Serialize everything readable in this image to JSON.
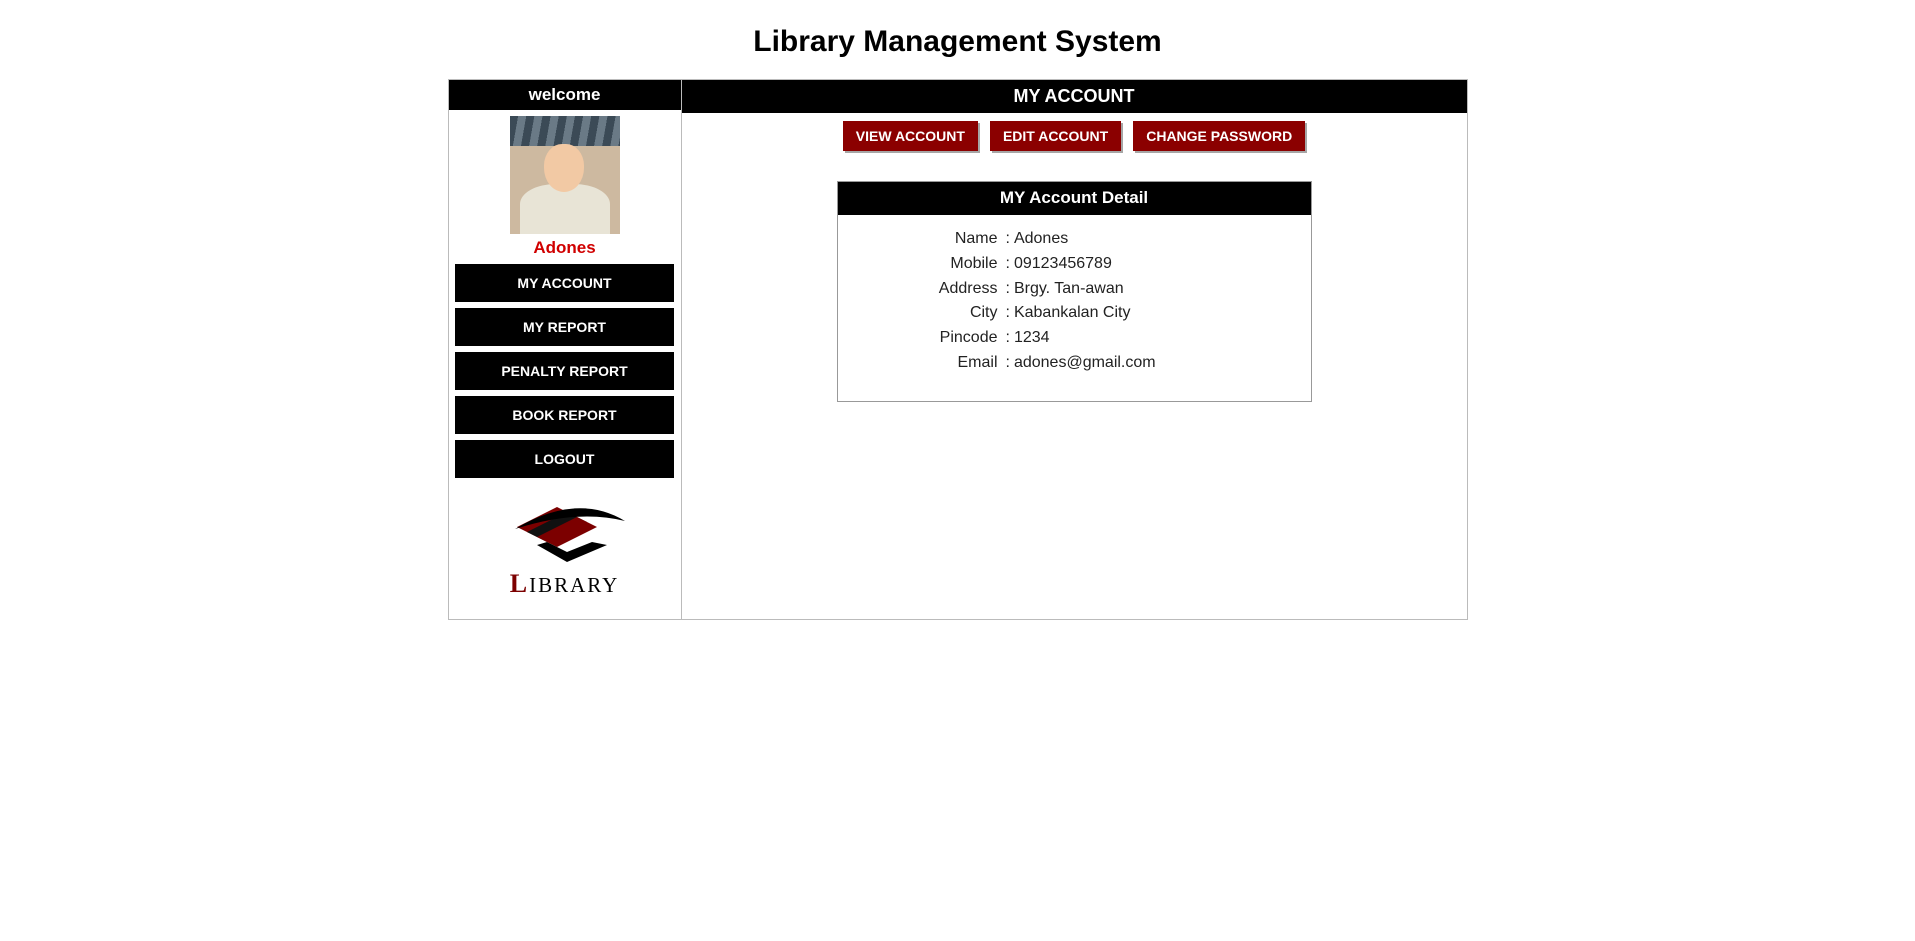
{
  "page_title": "Library Management System",
  "sidebar": {
    "welcome": "welcome",
    "username": "Adones",
    "nav": [
      "MY ACCOUNT",
      "MY REPORT",
      "PENALTY REPORT",
      "BOOK REPORT",
      "LOGOUT"
    ],
    "logo_label_first": "L",
    "logo_label_rest": "IBRARY"
  },
  "main": {
    "header": "MY ACCOUNT",
    "actions": [
      "VIEW ACCOUNT",
      "EDIT ACCOUNT",
      "CHANGE PASSWORD"
    ],
    "detail_header": "MY Account Detail",
    "fields": [
      {
        "label": "Name",
        "value": "Adones"
      },
      {
        "label": "Mobile",
        "value": "09123456789"
      },
      {
        "label": "Address",
        "value": "Brgy. Tan-awan"
      },
      {
        "label": "City",
        "value": "Kabankalan City"
      },
      {
        "label": "Pincode",
        "value": "1234"
      },
      {
        "label": "Email",
        "value": "adones@gmail.com"
      }
    ]
  }
}
